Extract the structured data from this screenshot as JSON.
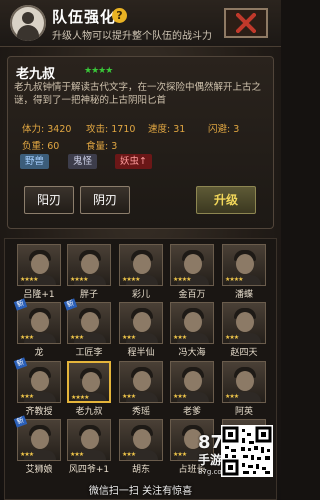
{
  "header": {
    "title": "队伍强化",
    "help_glyph": "?",
    "subtitle": "升级人物可以提升整个队伍的战斗力"
  },
  "character": {
    "name": "老九叔",
    "stars": "★★★★",
    "description": "老九叔钟情于解读古代文字，在一次探险中偶然解开上古之谜，得到了一把神秘的上古阴阳匕首",
    "stats": [
      {
        "label": "体力: ",
        "value": "3420"
      },
      {
        "label": "攻击: ",
        "value": "1710"
      },
      {
        "label": "速度: ",
        "value": "31"
      },
      {
        "label": "闪避: ",
        "value": "3"
      },
      {
        "label": "负重: ",
        "value": "60"
      },
      {
        "label": "食量: ",
        "value": "3"
      }
    ],
    "tags": [
      "野兽",
      "鬼怪",
      "妖虫"
    ],
    "tag_arrow": "↑"
  },
  "actions": {
    "yang_label": "阳刃",
    "yin_label": "阴刃",
    "upgrade_label": "升级"
  },
  "roster": {
    "new_badge": "新",
    "items": [
      {
        "name": "吕隆+1",
        "stars": "★★★★"
      },
      {
        "name": "胖子",
        "stars": "★★★★"
      },
      {
        "name": "彩儿",
        "stars": "★★★★"
      },
      {
        "name": "金百万",
        "stars": "★★★★"
      },
      {
        "name": "潘蝶",
        "stars": "★★★★"
      },
      {
        "name": "龙",
        "stars": "★★★"
      },
      {
        "name": "工匠李",
        "stars": "★★★"
      },
      {
        "name": "程半仙",
        "stars": "★★★"
      },
      {
        "name": "冯大海",
        "stars": "★★★"
      },
      {
        "name": "赵四天",
        "stars": "★★★"
      },
      {
        "name": "齐教授",
        "stars": "★★★"
      },
      {
        "name": "老九叔",
        "stars": "★★★★"
      },
      {
        "name": "秀瑶",
        "stars": "★★★"
      },
      {
        "name": "老爹",
        "stars": "★★★"
      },
      {
        "name": "阿英",
        "stars": "★★★"
      },
      {
        "name": "艾狮娘",
        "stars": "★★★"
      },
      {
        "name": "风四爷+1",
        "stars": "★★★"
      },
      {
        "name": "胡东",
        "stars": "★★★"
      },
      {
        "name": "占班长",
        "stars": "★★★"
      },
      {
        "name": "",
        "stars": ""
      }
    ]
  },
  "watermark": {
    "logo": "87G",
    "logo_sub": "手游网",
    "domain": "87g.com",
    "caption": "微信扫一扫 关注有惊喜"
  }
}
